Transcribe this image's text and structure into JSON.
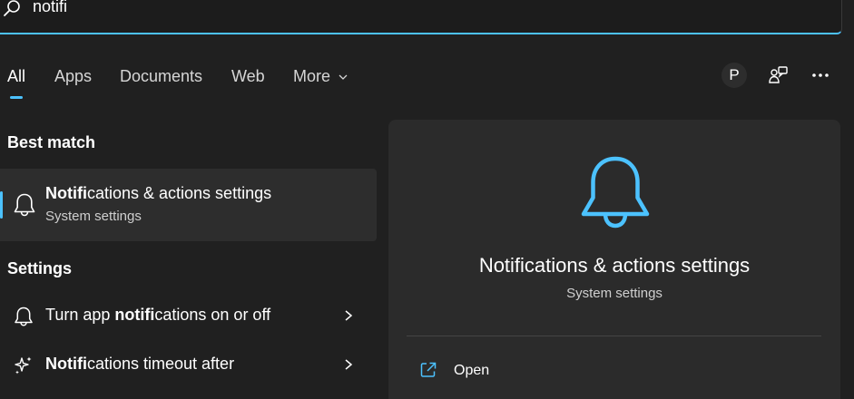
{
  "search": {
    "query": "notifi"
  },
  "tabs": [
    {
      "label": "All",
      "active": true
    },
    {
      "label": "Apps"
    },
    {
      "label": "Documents"
    },
    {
      "label": "Web"
    },
    {
      "label": "More"
    }
  ],
  "user": {
    "avatar_initial": "P"
  },
  "best_match": {
    "header": "Best match",
    "title_bold": "Notifi",
    "title_rest": "cations & actions settings",
    "subtitle": "System settings"
  },
  "settings": {
    "header": "Settings",
    "items": [
      {
        "pre": "Turn app ",
        "bold": "notifi",
        "post": "cations on or off",
        "icon": "bell-icon"
      },
      {
        "pre": "",
        "bold": "Notifi",
        "post": "cations timeout after",
        "icon": "sparkle-icon"
      }
    ]
  },
  "preview": {
    "title": "Notifications & actions settings",
    "subtitle": "System settings",
    "actions": [
      {
        "label": "Open",
        "icon": "open-external-icon"
      }
    ]
  },
  "colors": {
    "accent": "#4cc2ff",
    "background": "#202020",
    "panel": "#2b2b2b",
    "selected": "#2d2d2d"
  }
}
